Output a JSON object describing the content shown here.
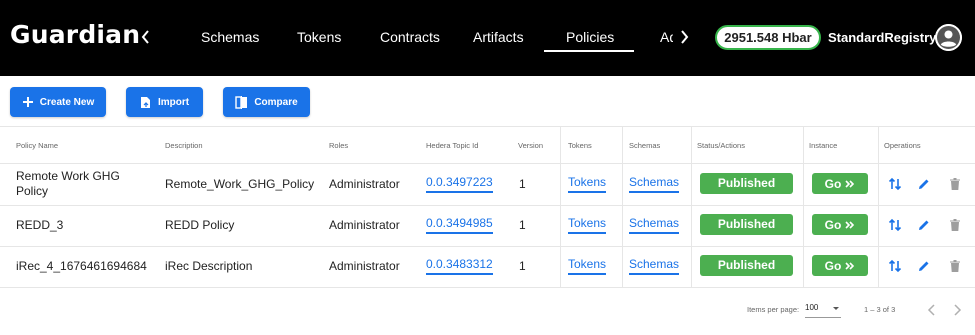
{
  "app": {
    "title": "Guardian"
  },
  "nav": {
    "tabs": [
      {
        "label": "Schemas"
      },
      {
        "label": "Tokens"
      },
      {
        "label": "Contracts"
      },
      {
        "label": "Artifacts"
      },
      {
        "label": "Policies",
        "active": true
      },
      {
        "label": "Ad"
      }
    ],
    "left_arrow_icon": "chevron-left-icon",
    "right_arrow_icon": "chevron-right-icon"
  },
  "account": {
    "balance": "2951.548 Hbar",
    "user_name": "StandardRegistry",
    "avatar_icon": "account-circle-icon"
  },
  "toolbar": {
    "create_label": "Create New",
    "import_label": "Import",
    "compare_label": "Compare"
  },
  "table": {
    "headers": {
      "policy_name": "Policy Name",
      "description": "Description",
      "roles": "Roles",
      "topic_id": "Hedera Topic Id",
      "version": "Version",
      "tokens": "Tokens",
      "schemas": "Schemas",
      "status": "Status/Actions",
      "instance": "Instance",
      "operations": "Operations"
    },
    "rows": [
      {
        "name_line1": "Remote Work GHG",
        "name_line2": "Policy",
        "description": "Remote_Work_GHG_Policy",
        "role": "Administrator",
        "topic_id": "0.0.3497223",
        "version": "1",
        "tokens": "Tokens",
        "schemas": "Schemas",
        "status": "Published",
        "instance": "Go"
      },
      {
        "name_line1": "REDD_3",
        "name_line2": "",
        "description": "REDD Policy",
        "role": "Administrator",
        "topic_id": "0.0.3494985",
        "version": "1",
        "tokens": "Tokens",
        "schemas": "Schemas",
        "status": "Published",
        "instance": "Go"
      },
      {
        "name_line1": "iRec_4_1676461694684",
        "name_line2": "",
        "description": "iRec Description",
        "role": "Administrator",
        "topic_id": "0.0.3483312",
        "version": "1",
        "tokens": "Tokens",
        "schemas": "Schemas",
        "status": "Published",
        "instance": "Go"
      }
    ]
  },
  "pagination": {
    "items_per_page_label": "Items per page:",
    "items_per_page_value": "100",
    "range": "1 – 3 of 3"
  },
  "colors": {
    "header_bg": "#000000",
    "primary": "#1a73e8",
    "success": "#4caf50",
    "balance_border": "#36b44a"
  }
}
